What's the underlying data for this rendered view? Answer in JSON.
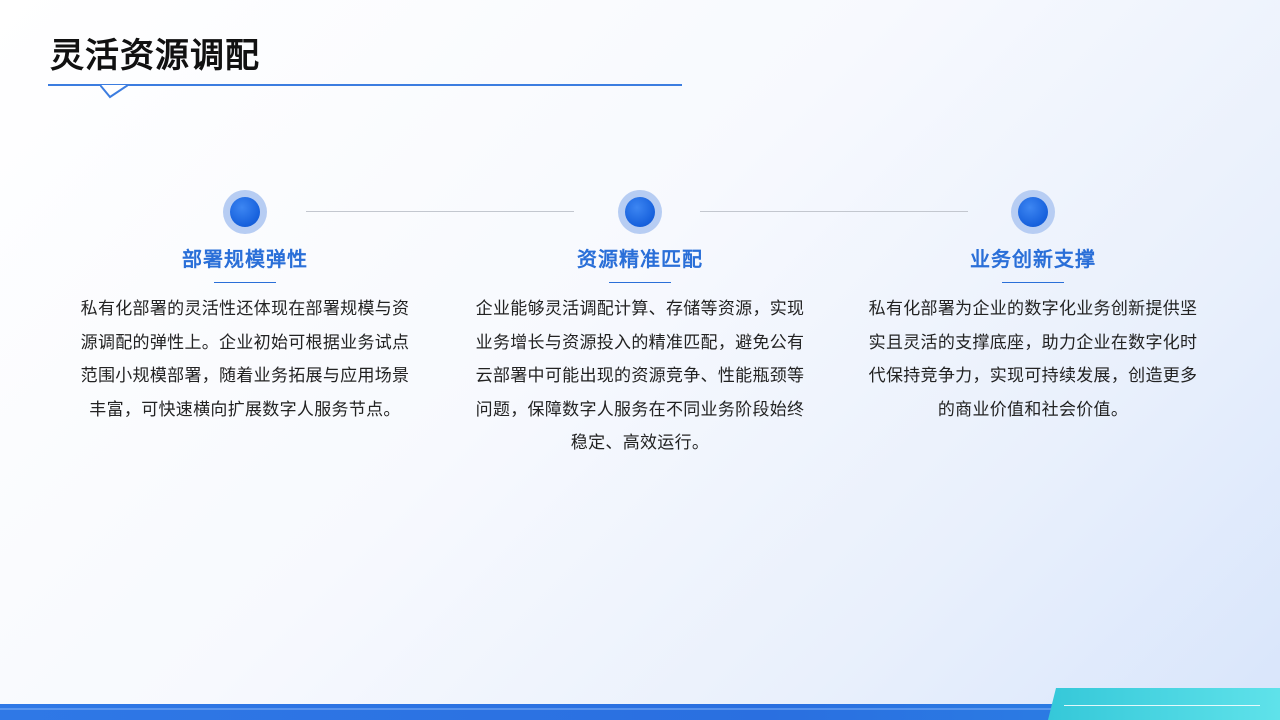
{
  "slide": {
    "title": "灵活资源调配"
  },
  "columns": [
    {
      "title": "部署规模弹性",
      "text": "私有化部署的灵活性还体现在部署规模与资源调配的弹性上。企业初始可根据业务试点范围小规模部署，随着业务拓展与应用场景丰富，可快速横向扩展数字人服务节点。"
    },
    {
      "title": "资源精准匹配",
      "text": "企业能够灵活调配计算、存储等资源，实现业务增长与资源投入的精准匹配，避免公有云部署中可能出现的资源竞争、性能瓶颈等问题，保障数字人服务在不同业务阶段始终稳定、高效运行。"
    },
    {
      "title": "业务创新支撑",
      "text": "私有化部署为企业的数字化业务创新提供坚实且灵活的支撑底座，助力企业在数字化时代保持竞争力，实现可持续发展，创造更多的商业价值和社会价值。"
    }
  ],
  "colors": {
    "accent": "#2a6fd8",
    "dot": "#1660dc",
    "teal": "#35c8d9"
  },
  "icons": [
    "bullet-dot-icon",
    "bullet-dot-icon",
    "bullet-dot-icon"
  ]
}
